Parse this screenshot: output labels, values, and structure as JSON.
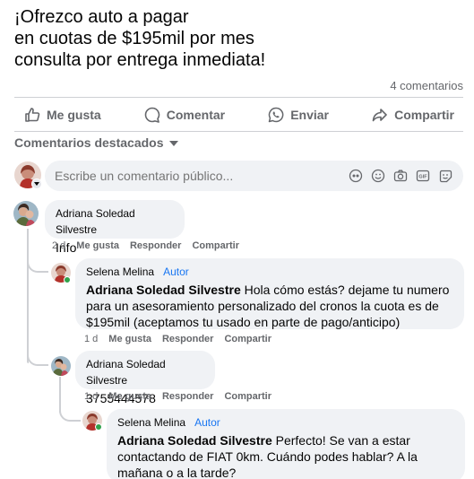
{
  "post": {
    "lines": [
      "¡Ofrezco auto a pagar",
      "en cuotas de $195mil por mes",
      "consulta por entrega inmediata!"
    ],
    "comment_count": "4 comentarios"
  },
  "actions": {
    "like": "Me gusta",
    "comment": "Comentar",
    "send": "Enviar",
    "share": "Compartir"
  },
  "featured_label": "Comentarios destacados",
  "compose": {
    "placeholder": "Escribe un comentario público..."
  },
  "comments": [
    {
      "name": "Adriana Soledad Silvestre",
      "text": "Info",
      "time": "2 d",
      "like": "Me gusta",
      "reply": "Responder",
      "share": "Compartir"
    },
    {
      "name": "Selena Melina",
      "author": "Autor",
      "mention": "Adriana Soledad Silvestre",
      "text_lines": [
        " Hola cómo estás? dejame tu numero",
        "para un asesoramiento personalizado del cronos la cuota es de",
        "$195mil (aceptamos tu usado en parte de pago/anticipo)"
      ],
      "time": "1 d",
      "like": "Me gusta",
      "reply": "Responder",
      "share": "Compartir"
    },
    {
      "name": "Adriana Soledad Silvestre",
      "text": "3755444578",
      "time": "1 d",
      "like": "Me gusta",
      "reply": "Responder",
      "share": "Compartir"
    },
    {
      "name": "Selena Melina",
      "author": "Autor",
      "mention": "Adriana Soledad Silvestre",
      "text_lines": [
        " Perfecto! Se van a estar",
        "contactando de FIAT 0km. Cuándo podes hablar? A la",
        "mañana o a la tarde?"
      ]
    }
  ],
  "colors": {
    "accent": "#1876f2",
    "secondary_text": "#65676b",
    "bubble": "#f0f2f5",
    "online": "#31a24c"
  }
}
